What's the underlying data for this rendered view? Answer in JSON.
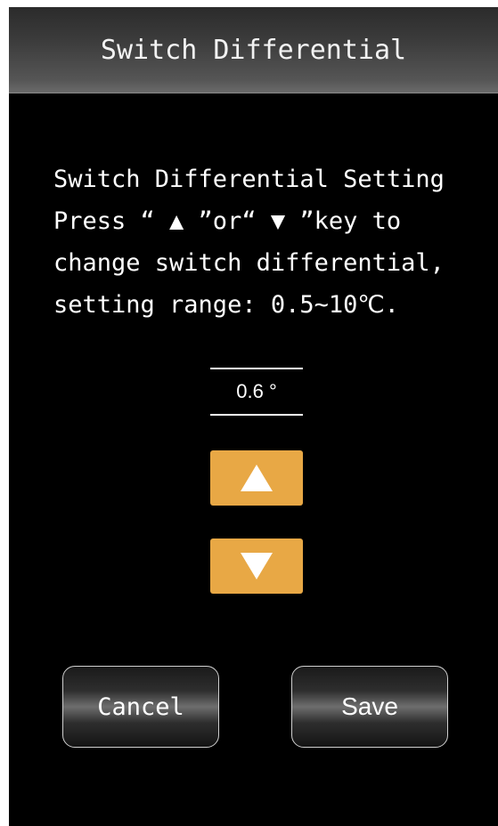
{
  "header": {
    "title": "Switch Differential"
  },
  "description": {
    "line1": "Switch Differential Setting",
    "line2": "Press “ ▲ ”or“ ▼ ”key to",
    "line3": "change switch differential,",
    "line4": "setting range: 0.5~10℃."
  },
  "setting": {
    "value": "0.6 °"
  },
  "controls": {
    "up_icon": "triangle-up-icon",
    "down_icon": "triangle-down-icon",
    "accent_color": "#e8a845"
  },
  "actions": {
    "cancel_label": "Cancel",
    "save_label": "Save"
  }
}
